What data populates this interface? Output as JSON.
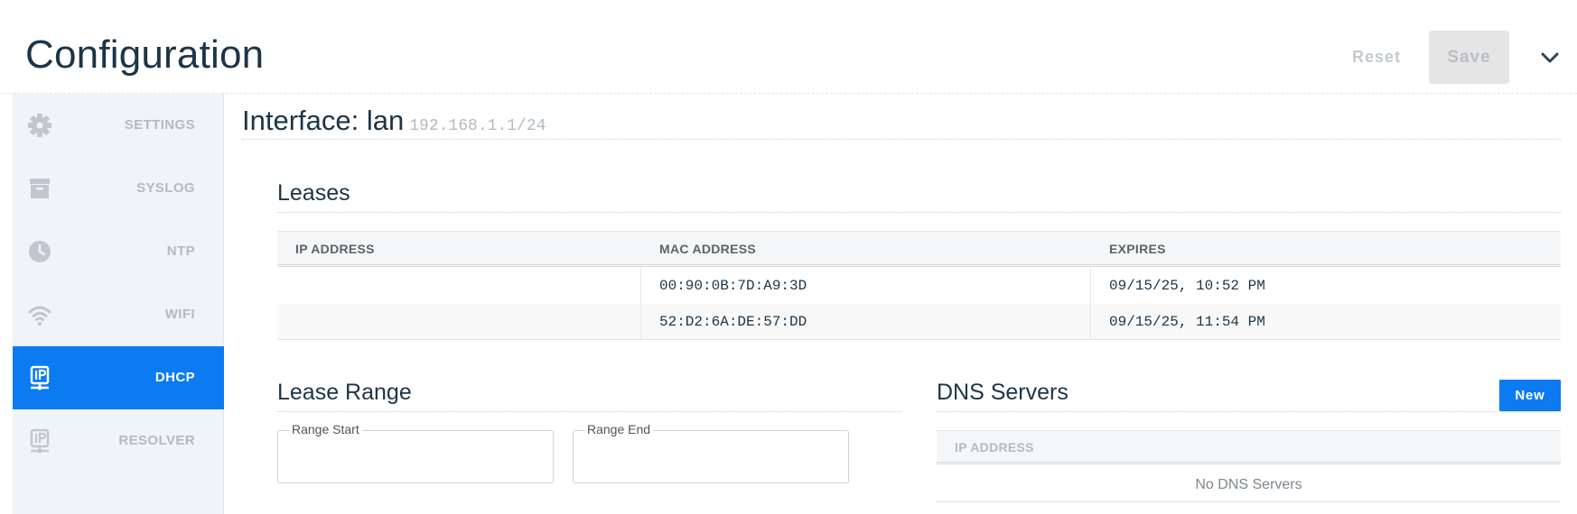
{
  "header": {
    "title": "Configuration",
    "reset_label": "Reset",
    "save_label": "Save",
    "collapse_icon": "chevron-down-icon"
  },
  "sidebar": {
    "items": [
      {
        "label": "SETTINGS",
        "icon": "gear-icon",
        "active": false
      },
      {
        "label": "SYSLOG",
        "icon": "archive-box-icon",
        "active": false
      },
      {
        "label": "NTP",
        "icon": "clock-icon",
        "active": false
      },
      {
        "label": "WIFI",
        "icon": "wifi-icon",
        "active": false
      },
      {
        "label": "DHCP",
        "icon": "ip-network-icon",
        "active": true
      },
      {
        "label": "RESOLVER",
        "icon": "ip-network-icon",
        "active": false
      }
    ]
  },
  "interface": {
    "title": "Interface: lan",
    "address": "192.168.1.1/24"
  },
  "leases": {
    "title": "Leases",
    "columns": [
      "IP ADDRESS",
      "MAC ADDRESS",
      "EXPIRES"
    ],
    "rows": [
      {
        "ip": "",
        "mac": "00:90:0B:7D:A9:3D",
        "expires": "09/15/25, 10:52 PM"
      },
      {
        "ip": "",
        "mac": "52:D2:6A:DE:57:DD",
        "expires": "09/15/25, 11:54 PM"
      }
    ]
  },
  "lease_range": {
    "title": "Lease Range",
    "start_label": "Range Start",
    "start_value": "",
    "end_label": "Range End",
    "end_value": ""
  },
  "dns_servers": {
    "title": "DNS Servers",
    "new_label": "New",
    "column": "IP ADDRESS",
    "empty_text": "No DNS Servers"
  },
  "colors": {
    "accent": "#0c7bf2",
    "title_text": "#1c3547",
    "sidebar_bg": "#eff4f9",
    "muted_text": "#b3bac1"
  }
}
